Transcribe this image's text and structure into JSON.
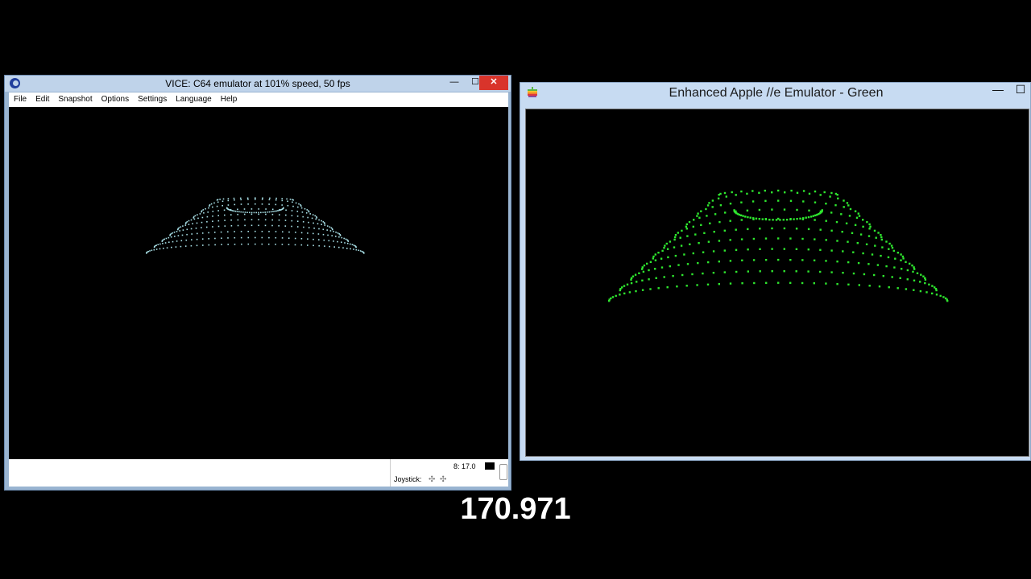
{
  "vice": {
    "title": "VICE: C64 emulator at 101% speed, 50 fps",
    "menu": [
      "File",
      "Edit",
      "Snapshot",
      "Options",
      "Settings",
      "Language",
      "Help"
    ],
    "controls": {
      "minimize": "—",
      "maximize": "☐",
      "close": "✕"
    },
    "status": {
      "drive": "8: 17.0",
      "joystick_label": "Joystick:"
    },
    "dot_color": "#a8dfe6"
  },
  "apple": {
    "title": "Enhanced Apple //e Emulator - Green",
    "controls": {
      "minimize": "—",
      "maximize": "☐"
    },
    "dot_color": "#2ee62e"
  },
  "counter": "170.971"
}
